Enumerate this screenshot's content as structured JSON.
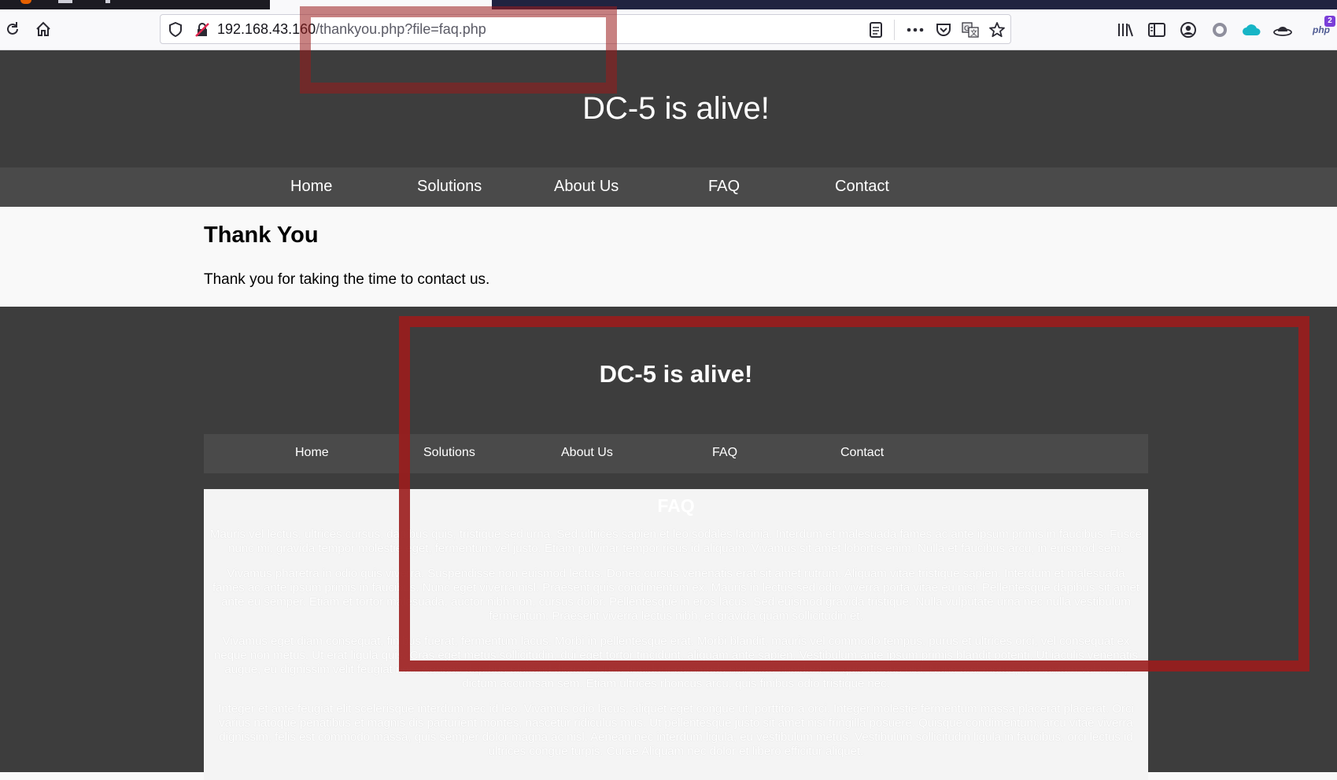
{
  "browser": {
    "url_host": "192.168.43.160",
    "url_path": "/thankyou.php?file=faq.php",
    "php_badge": "php",
    "php_count": "2",
    "icons": [
      "reload-icon",
      "home-icon",
      "shield-icon",
      "insecure-lock-icon",
      "reader-view-icon",
      "more-icon",
      "pocket-icon",
      "translate-icon",
      "star-icon",
      "library-icon",
      "sidebar-icon",
      "account-icon",
      "extension-circle-icon",
      "cloud-icon",
      "hat-icon",
      "php-icon"
    ]
  },
  "site": {
    "title": "DC-5 is alive!",
    "nav": [
      "Home",
      "Solutions",
      "About Us",
      "FAQ",
      "Contact"
    ]
  },
  "content": {
    "heading": "Thank You",
    "body": "Thank you for taking the time to contact us."
  },
  "included_page": {
    "title": "DC-5 is alive!",
    "nav": [
      "Home",
      "Solutions",
      "About Us",
      "FAQ",
      "Contact"
    ],
    "heading": "FAQ",
    "paragraphs": [
      "Mauris vel lectus, ultrices cursus, dapibus quis, tristique sed urna. Sed ultrices sapien et leo sodales lacinia. Interdum et malesuada fames ac ante ipsum primis in faucibus. Fusce nunc mi, gravida tempor molestie eget, fermentum vel justo. Etiam pulvinar tempor risus id aliquam. Vivamus sit amet lobortis enim. Nulla et faucibus arcu, in euismod sem.",
      "Vivamus pharetra in odio quis viverra. Suspendisse non euismod lectus. Donec cursus venenatis erat sit amet rutrum. Aliquam vitae tristique sapien. Interdum et malesuada fames ac ante ipsum primis in faucibus. Nunc eget viverra nisl. Praesent quis condimentum ex. Mauris in lectus sed odio viverra porta vitae eu nisi. Pellentesque dapibus sit amet ante eu semper. Etiam et tortor malesuada, auctor nibh non, cursus dolor. Pellentesque in eros lacus. Sed euismod gravida tristique. Nulla vulputate urna nec nulla vestibulum fermentum. Praesent viverra lectus nibh, et gravida quam sollicitudin et.",
      "Vivamus eget diam consequat, finibus fuerat, fermentum lacus. Morbi in pellentesque erat. Morbi blandit, mauris vel commodo tempus, purus et ultrices orci, vel consequat ex neque non metus. Ut erat ligula quis. Cras eget metus sollicitudin, dui eget tortor tincidunt, aliquam ante sapien. Vestibulum ante ipsum primis blandit potenti. Ut iaculis venenatis augue, eu dignissim velit feugiat non. Aenean dapibus eleifend dictum. Nunc tincidunt commodo nisi vitae tincidunt. In quis cursus nisl. Nunc orci metus, fermentum vel mi in, dictum accumsan sem. Etiam ultrices rhoncus arcu, quis finibus odio tristique nec.",
      "Integer et ante feugiat elit scelerisque interdum nec id leo. Vivamus odio lacus, aliquet eget congue ut, porttitor a orci. Integer molestie fermentum massa placerat placerat. Orci varius natoque penatibus et magnis dis parturient montes, nascetur ridiculus mus. Ut pellentesque justo sit amet nisi fringilla posuere. Quisque condimentum, arcu vitae viverra dignissim, felis est commodo massa, quis semper dolor magna ac nisl. Aenean nec interdum ligula, eu vestibulum metus. Vestibulum sollicitudin ligula in faucibus, orci lectus id ultrices congue turpis. Curae Aliquam nec dolor et libero efficitur aliquet."
    ]
  },
  "colors": {
    "header_bg": "#3d3d3d",
    "nav_bg": "#4a4a4a",
    "annotation": "#9b1c1c"
  }
}
